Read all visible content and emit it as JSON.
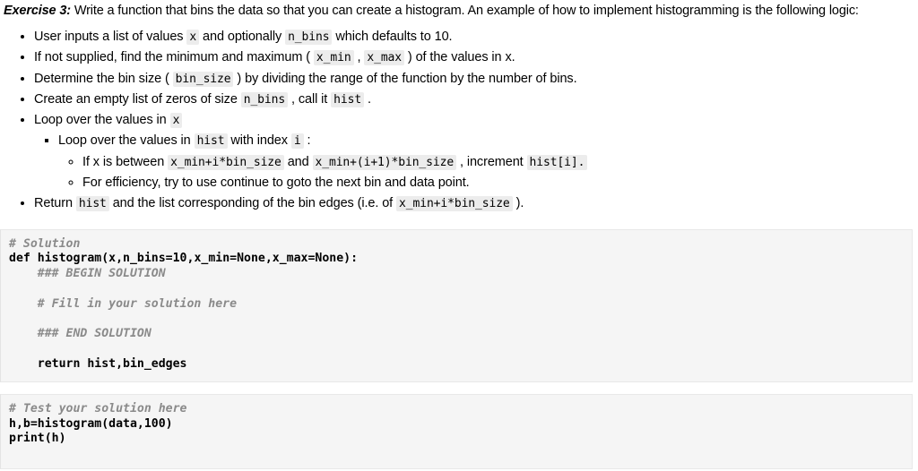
{
  "prompt": {
    "exercise_label": "Exercise 3:",
    "text": " Write a function that bins the data so that you can create a histogram. An example of how to implement histogramming is the following logic:"
  },
  "bullets": {
    "b1": {
      "p1": "User inputs a list of values ",
      "c1": "x",
      "p2": " and optionally ",
      "c2": "n_bins",
      "p3": " which defaults to 10."
    },
    "b2": {
      "p1": "If not supplied, find the minimum and maximum ( ",
      "c1": "x_min",
      "p2": " , ",
      "c2": "x_max",
      "p3": " ) of the values in x."
    },
    "b3": {
      "p1": "Determine the bin size ( ",
      "c1": "bin_size",
      "p2": " ) by dividing the range of the function by the number of bins."
    },
    "b4": {
      "p1": "Create an empty list of zeros of size ",
      "c1": "n_bins",
      "p2": " , call it ",
      "c2": "hist",
      "p3": " ."
    },
    "b5": {
      "p1": "Loop over the values in ",
      "c1": "x"
    },
    "b5_1": {
      "p1": "Loop over the values in ",
      "c1": "hist",
      "p2": " with index ",
      "c2": "i",
      "p3": " :"
    },
    "b5_1_1": {
      "p1": "If x is between ",
      "c1": "x_min+i*bin_size",
      "p2": " and ",
      "c2": "x_min+(i+1)*bin_size",
      "p3": " , increment ",
      "c3": "hist[i]."
    },
    "b5_1_2": {
      "p1": "For efficiency, try to use continue to goto the next bin and data point."
    },
    "b6": {
      "p1": "Return ",
      "c1": "hist",
      "p2": " and the list corresponding of the bin edges (i.e. of ",
      "c2": "x_min+i*bin_size",
      "p3": " )."
    }
  },
  "cells": [
    {
      "name": "solution-cell",
      "lines": [
        {
          "comment": "# Solution"
        },
        {
          "code_def": "def",
          "code_rest": " histogram(x,n_bins=10,x_min=None,x_max=None):"
        },
        {
          "comment_indent": "    ### BEGIN SOLUTION"
        },
        {
          "blank": ""
        },
        {
          "comment_indent": "    # Fill in your solution here"
        },
        {
          "blank": ""
        },
        {
          "comment_indent": "    ### END SOLUTION"
        },
        {
          "blank": ""
        },
        {
          "return_line": "    return hist,bin_edges"
        }
      ]
    },
    {
      "name": "test-cell",
      "lines": [
        {
          "comment": "# Test your solution here"
        },
        {
          "plain_bold": "h,b=histogram(data,100)"
        },
        {
          "plain_bold2": "print(h)"
        }
      ]
    }
  ],
  "code_text": {
    "sol_comment_1": "# Solution",
    "sol_def_kw": "def",
    "sol_def_rest": " histogram(x,n_bins=10,x_min=None,x_max=None):",
    "sol_begin": "    ### BEGIN SOLUTION",
    "sol_fill": "    # Fill in your solution here",
    "sol_end": "    ### END SOLUTION",
    "sol_return": "    return hist,bin_edges",
    "test_comment": "# Test your solution here",
    "test_call": "h,b=histogram(data,100)",
    "test_print": "print(h)"
  },
  "colors": {
    "cell_bg": "#f5f5f5",
    "cell_border": "#e8e8e8",
    "inline_code_bg": "#ececec",
    "comment": "#8a8a8a",
    "text": "#000000"
  }
}
